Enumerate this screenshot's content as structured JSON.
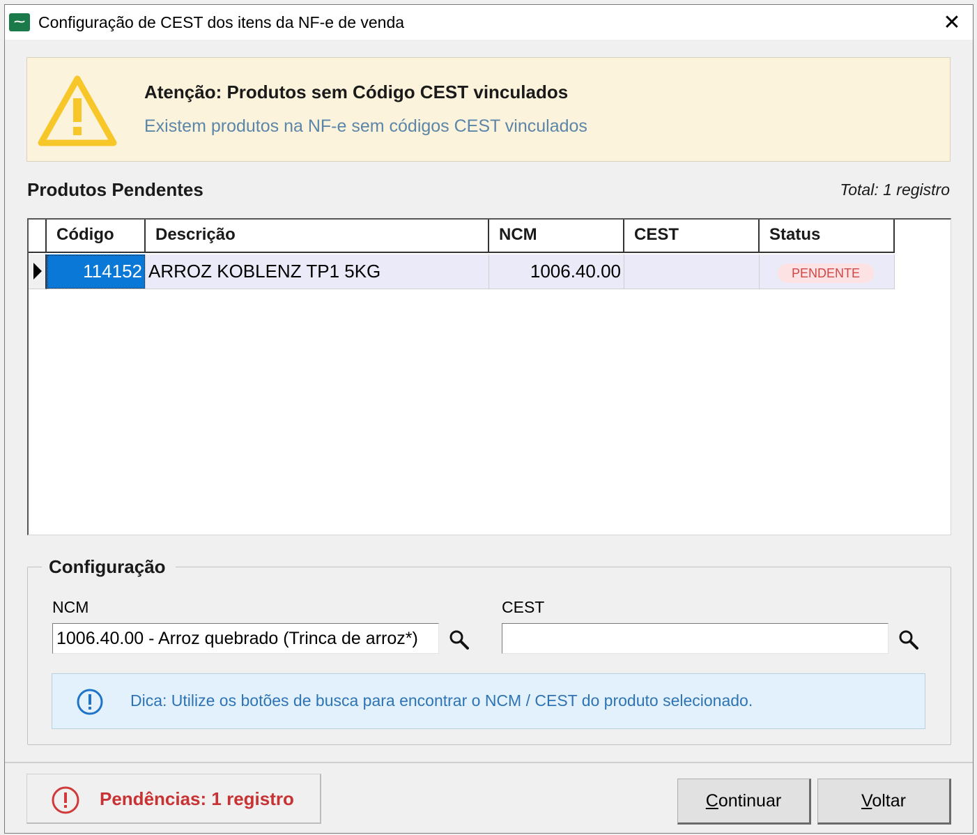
{
  "window": {
    "title": "Configuração de CEST dos itens da NF-e de venda",
    "icon": "app-logo-icon",
    "close_glyph": "✕"
  },
  "warning": {
    "title": "Atenção: Produtos sem Código CEST vinculados",
    "subtitle": "Existem produtos na NF-e sem códigos CEST vinculados",
    "icon": "warning-triangle-icon",
    "color": "#f7c72a"
  },
  "products": {
    "title": "Produtos Pendentes",
    "total": "Total: 1 registro",
    "columns": [
      "Código",
      "Descrição",
      "NCM",
      "CEST",
      "Status"
    ],
    "rows": [
      {
        "codigo": "114152",
        "descricao": "ARROZ KOBLENZ TP1 5KG",
        "ncm": "1006.40.00",
        "cest": "",
        "status": "PENDENTE"
      }
    ]
  },
  "config": {
    "title": "Configuração",
    "ncm_label": "NCM",
    "ncm_value": "1006.40.00 - Arroz quebrado (Trinca de arroz*)",
    "cest_label": "CEST",
    "cest_value": "",
    "tip": "Dica: Utilize os botões de busca para encontrar o NCM / CEST do produto selecionado.",
    "tip_icon": "info-circle-icon"
  },
  "footer": {
    "pendencias": "Pendências: 1 registro",
    "pendencias_icon": "alert-circle-icon",
    "continuar_mnemonic": "C",
    "continuar_rest": "ontinuar",
    "voltar_mnemonic": "V",
    "voltar_rest": "oltar"
  },
  "colors": {
    "selection": "#0a78d7",
    "status_bg": "#fde2e4",
    "status_text": "#d04646",
    "pending_text": "#c83232",
    "tip_bg": "#e2f1fc",
    "tip_text": "#2e74b4",
    "warning_bg": "#fcf3dc"
  }
}
